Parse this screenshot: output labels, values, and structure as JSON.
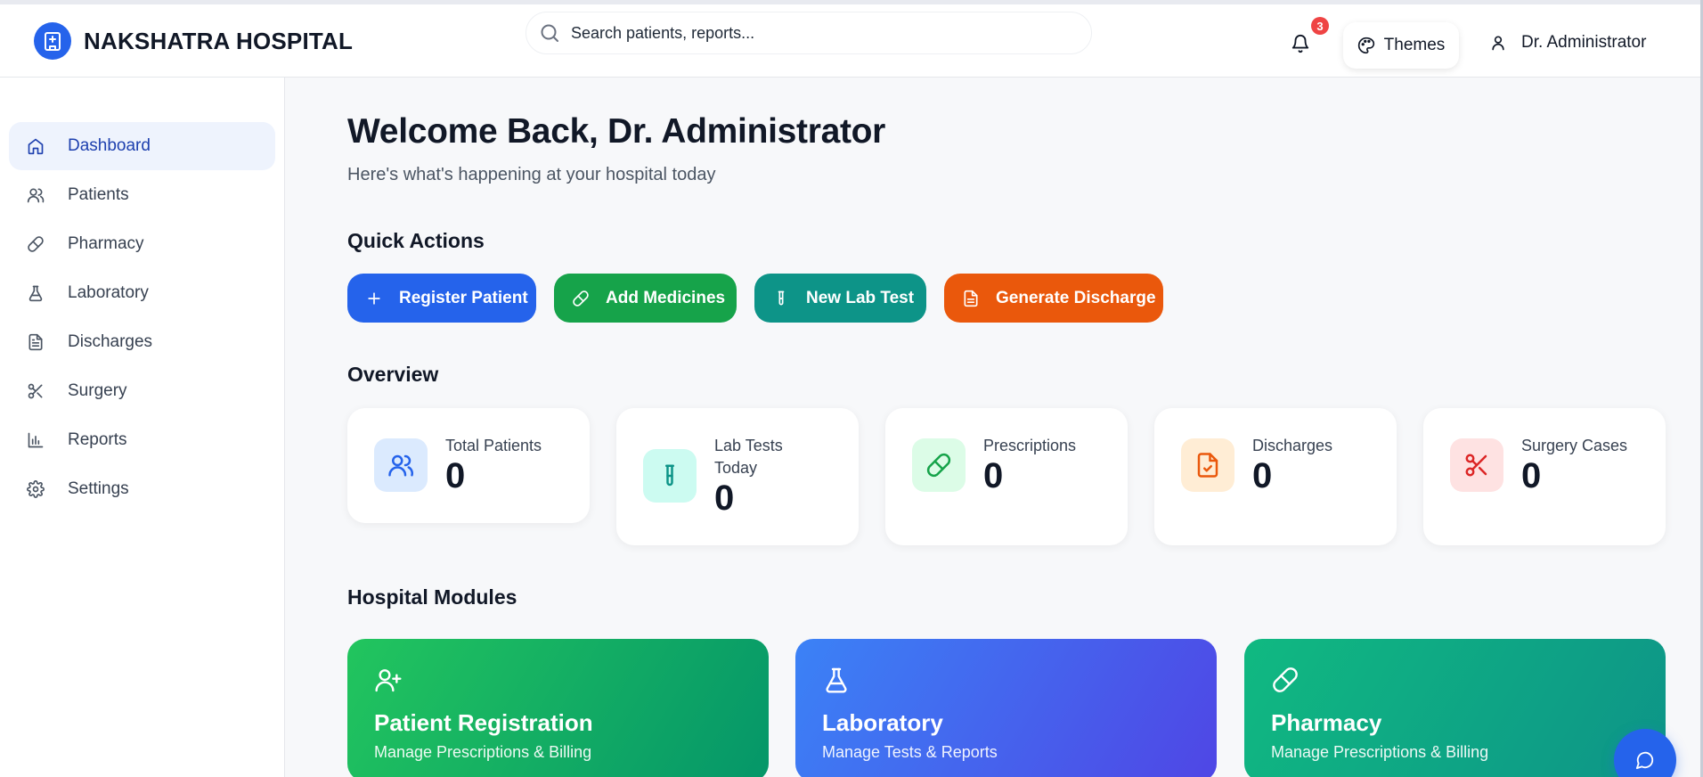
{
  "header": {
    "brand_name": "NAKSHATRA HOSPITAL",
    "search_placeholder": "Search patients, reports...",
    "notification_count": "3",
    "themes_label": "Themes",
    "user_name": "Dr. Administrator"
  },
  "sidebar": {
    "items": [
      {
        "label": "Dashboard",
        "icon": "home-icon",
        "active": true
      },
      {
        "label": "Patients",
        "icon": "users-icon",
        "active": false
      },
      {
        "label": "Pharmacy",
        "icon": "pill-icon",
        "active": false
      },
      {
        "label": "Laboratory",
        "icon": "flask-icon",
        "active": false
      },
      {
        "label": "Discharges",
        "icon": "document-icon",
        "active": false
      },
      {
        "label": "Surgery",
        "icon": "scissors-icon",
        "active": false
      },
      {
        "label": "Reports",
        "icon": "bar-chart-icon",
        "active": false
      },
      {
        "label": "Settings",
        "icon": "gear-icon",
        "active": false
      }
    ]
  },
  "main": {
    "welcome_title": "Welcome Back, Dr. Administrator",
    "subtitle": "Here's what's happening at your hospital today",
    "quick_actions_title": "Quick Actions",
    "quick_actions": [
      {
        "label": "Register Patient",
        "icon": "plus-icon",
        "color": "#2563eb"
      },
      {
        "label": "Add Medicines",
        "icon": "pill-icon",
        "color": "#16a34a"
      },
      {
        "label": "New Lab Test",
        "icon": "test-tube-icon",
        "color": "#0d9488"
      },
      {
        "label": "Generate Discharge",
        "icon": "document-icon",
        "color": "#ea580c"
      }
    ],
    "overview_title": "Overview",
    "stats": [
      {
        "label": "Total Patients",
        "value": "0",
        "icon": "users-icon",
        "icon_bg": "#dbeafe",
        "icon_color": "#2563eb"
      },
      {
        "label": "Lab Tests Today",
        "value": "0",
        "icon": "test-tube-icon",
        "icon_bg": "#ccfbf1",
        "icon_color": "#0d9488"
      },
      {
        "label": "Prescriptions",
        "value": "0",
        "icon": "pill-icon",
        "icon_bg": "#dcfce7",
        "icon_color": "#16a34a"
      },
      {
        "label": "Discharges",
        "value": "0",
        "icon": "file-check-icon",
        "icon_bg": "#ffedd5",
        "icon_color": "#ea580c"
      },
      {
        "label": "Surgery Cases",
        "value": "0",
        "icon": "scissors-icon",
        "icon_bg": "#fee2e2",
        "icon_color": "#dc2626"
      }
    ],
    "modules_title": "Hospital Modules",
    "modules": [
      {
        "title": "Patient Registration",
        "description": "Manage Prescriptions & Billing",
        "icon": "user-plus-icon",
        "gradient": [
          "#22c55e",
          "#059669"
        ]
      },
      {
        "title": "Laboratory",
        "description": "Manage Tests & Reports",
        "icon": "flask-icon",
        "gradient": [
          "#3b82f6",
          "#4f46e5"
        ]
      },
      {
        "title": "Pharmacy",
        "description": "Manage Prescriptions & Billing",
        "icon": "pill-icon",
        "gradient": [
          "#10b981",
          "#0d9488"
        ]
      }
    ]
  },
  "chat": {
    "icon": "chat-bubble-icon"
  }
}
